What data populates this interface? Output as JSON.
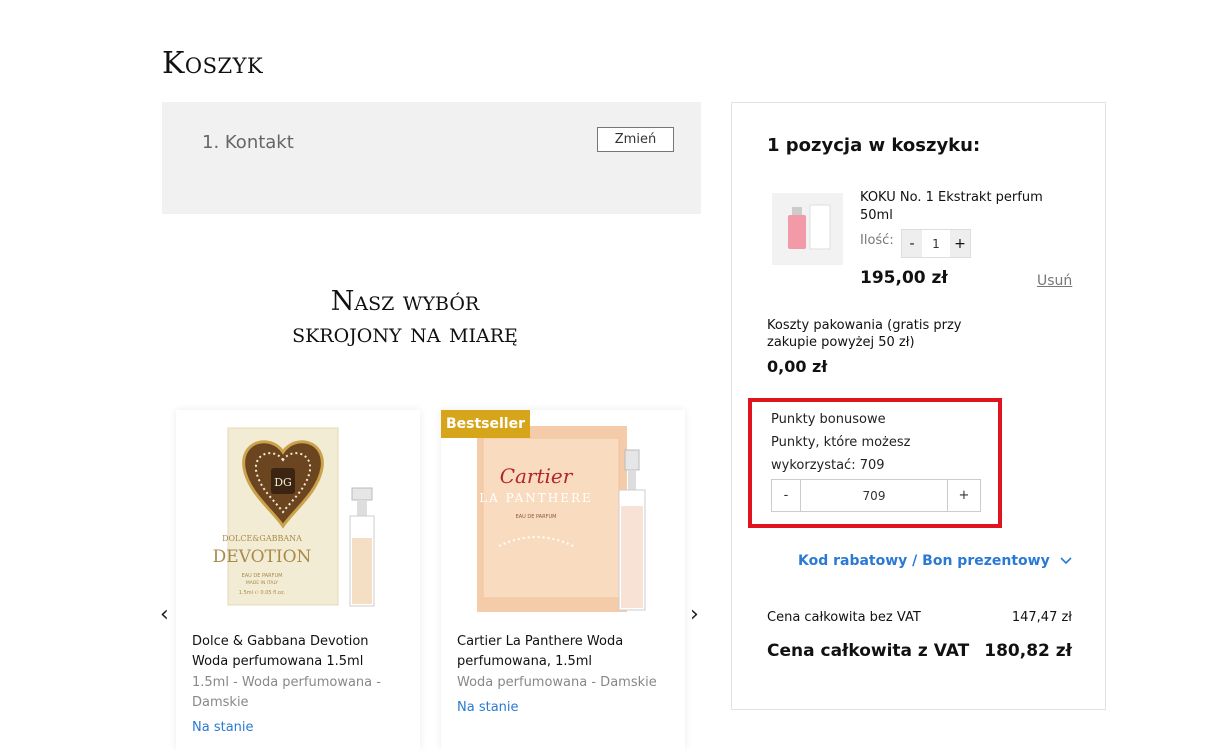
{
  "page": {
    "title": "Koszyk"
  },
  "contact": {
    "title": "1. Kontakt",
    "change_label": "Zmień"
  },
  "recommendations": {
    "title_line1": "Nasz wybór",
    "title_line2": "skrojony na miarę",
    "badge": "Bestseller",
    "prev_icon": "chevron-left-icon",
    "next_icon": "chevron-right-icon",
    "products": [
      {
        "name": "Dolce & Gabbana Devotion Woda perfumowana 1.5ml",
        "subtitle": "1.5ml - Woda perfumowana - Damskie",
        "stock": "Na stanie",
        "image_text": {
          "logo": "DG",
          "brand": "DOLCE&GABBANA",
          "line": "DEVOTION",
          "type": "EAU DE PARFUM",
          "origin": "MADE IN ITALY",
          "size": "1.5ml ℮ 0.05 fl.oz."
        }
      },
      {
        "name": "Cartier La Panthere Woda perfumowana, 1.5ml",
        "subtitle": "Woda perfumowana - Damskie",
        "stock": "Na stanie",
        "image_text": {
          "brand": "Cartier",
          "line": "LA PANTHERE",
          "type": "EAU DE PARFUM"
        }
      }
    ]
  },
  "cart": {
    "title": "1 pozycja w koszyku:",
    "item": {
      "name": "KOKU No. 1 Ekstrakt perfum 50ml",
      "qty_label": "Ilość:",
      "minus": "-",
      "qty": "1",
      "plus": "+",
      "price": "195,00 zł",
      "remove": "Usuń"
    },
    "packaging": {
      "label": "Koszty pakowania (gratis przy zakupie powyżej 50 zł)",
      "price": "0,00 zł"
    },
    "bonus": {
      "title": "Punkty bonusowe",
      "line1": "Punkty, które możesz",
      "line2": "wykorzystać: 709",
      "minus": "-",
      "value": "709",
      "plus": "+"
    },
    "coupon": {
      "label": "Kod rabatowy / Bon prezentowy",
      "icon": "chevron-down-icon"
    },
    "totals": {
      "net_label": "Cena całkowita bez VAT",
      "net_value": "147,47 zł",
      "gross_label": "Cena całkowita z VAT",
      "gross_value": "180,82 zł"
    }
  },
  "colors": {
    "link_blue": "#2a7ad4",
    "badge_gold": "#d6a51a",
    "highlight_red": "#e0141e",
    "panel_gray": "#f1f1f1"
  }
}
